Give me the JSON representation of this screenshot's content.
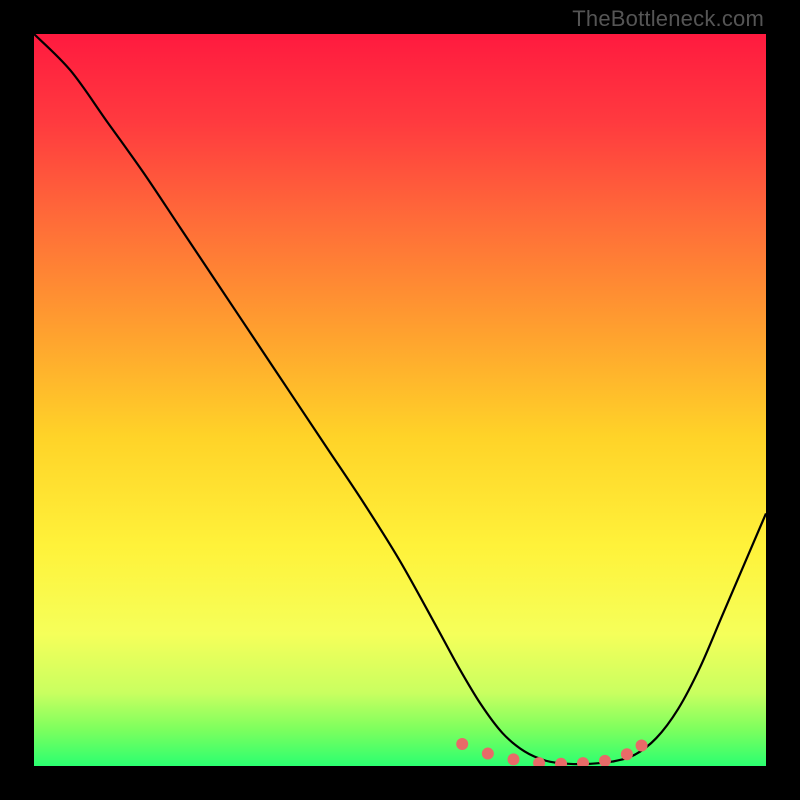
{
  "watermark": "TheBottleneck.com",
  "chart_data": {
    "type": "line",
    "title": "",
    "xlabel": "",
    "ylabel": "",
    "xlim": [
      0,
      1
    ],
    "ylim": [
      0,
      1
    ],
    "grid": false,
    "legend": false,
    "gradient_stops": [
      {
        "offset": 0.0,
        "color": "#ff1a3f"
      },
      {
        "offset": 0.12,
        "color": "#ff3a3f"
      },
      {
        "offset": 0.25,
        "color": "#ff6a39"
      },
      {
        "offset": 0.4,
        "color": "#ff9e2f"
      },
      {
        "offset": 0.55,
        "color": "#ffd328"
      },
      {
        "offset": 0.7,
        "color": "#fff23a"
      },
      {
        "offset": 0.82,
        "color": "#f5ff5a"
      },
      {
        "offset": 0.9,
        "color": "#c9ff60"
      },
      {
        "offset": 0.95,
        "color": "#7dff5e"
      },
      {
        "offset": 1.0,
        "color": "#2bff70"
      }
    ],
    "series": [
      {
        "name": "curve",
        "color": "#000000",
        "width": 2.2,
        "x": [
          0.0,
          0.05,
          0.1,
          0.15,
          0.2,
          0.25,
          0.3,
          0.35,
          0.4,
          0.45,
          0.5,
          0.55,
          0.58,
          0.61,
          0.64,
          0.67,
          0.7,
          0.73,
          0.76,
          0.79,
          0.82,
          0.85,
          0.88,
          0.91,
          0.94,
          0.97,
          1.0
        ],
        "y": [
          1.0,
          0.95,
          0.88,
          0.81,
          0.735,
          0.66,
          0.585,
          0.51,
          0.435,
          0.36,
          0.28,
          0.19,
          0.135,
          0.085,
          0.045,
          0.02,
          0.007,
          0.003,
          0.003,
          0.006,
          0.015,
          0.038,
          0.078,
          0.135,
          0.205,
          0.275,
          0.345
        ]
      }
    ],
    "markers": {
      "name": "trough-dots",
      "color": "#e86a68",
      "radius_px": 6,
      "x": [
        0.585,
        0.62,
        0.655,
        0.69,
        0.72,
        0.75,
        0.78,
        0.81,
        0.83
      ],
      "y": [
        0.03,
        0.017,
        0.009,
        0.004,
        0.003,
        0.004,
        0.007,
        0.016,
        0.028
      ]
    }
  }
}
